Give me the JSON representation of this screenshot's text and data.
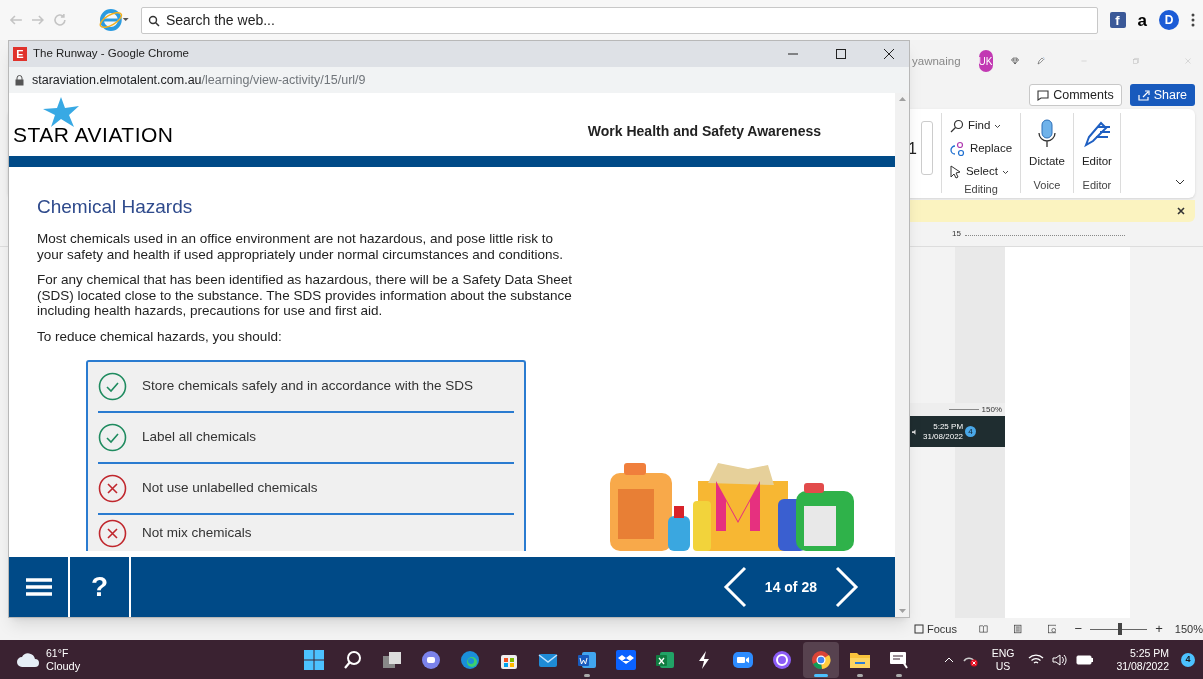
{
  "browser": {
    "search": {
      "placeholder": "Search the web..."
    },
    "extensions": [
      {
        "kind": "facebook",
        "glyph": "f"
      },
      {
        "kind": "amazon",
        "glyph": "a"
      },
      {
        "kind": "dashlane",
        "glyph": "D"
      }
    ]
  },
  "word": {
    "user": "yawnaing",
    "avatar": "UK",
    "buttons": [
      {
        "kind": "comments",
        "label": "Comments"
      },
      {
        "kind": "share",
        "label": "Share"
      }
    ],
    "font_size": "1",
    "ribbon_groups": [
      {
        "kind": "editing",
        "label": "Editing",
        "items": [
          {
            "kind": "find",
            "label": "Find"
          },
          {
            "kind": "replace",
            "label": "Replace"
          },
          {
            "kind": "select",
            "label": "Select"
          }
        ]
      },
      {
        "kind": "voice",
        "label": "Voice",
        "items": [
          {
            "kind": "dictate",
            "label": "Dictate"
          }
        ]
      },
      {
        "kind": "editor",
        "label": "Editor",
        "items": [
          {
            "kind": "editor",
            "label": "Editor"
          }
        ]
      }
    ],
    "ruler_label": "15",
    "pasted_screenshot": {
      "zoom": "150%",
      "time": "5:25 PM",
      "date": "31/08/2022",
      "badge": "4"
    },
    "status_bar": {
      "focus": "Focus",
      "zoom_out": "−",
      "zoom_slider": {
        "level": 0.55
      },
      "zoom_in": "+",
      "zoom": "150%"
    }
  },
  "popup": {
    "app_icon": "E",
    "title": "The Runway - Google Chrome",
    "url_domain": "staraviation.elmotalent.com.au",
    "url_path": "/learning/view-activity/15/url/9",
    "course": {
      "logo": "STAR AVIATION",
      "course_title": "Work Health and Safety Awareness",
      "heading": "Chemical Hazards",
      "paragraphs": [
        "Most chemicals used in an office environment are not hazardous, and pose little risk to your safety and health if used appropriately under normal circumstances and conditions.",
        "For any chemical that has been identified as hazardous, there will be a Safety Data Sheet (SDS) located close to the substance. The SDS provides information about the substance including health hazards, precautions for use and first aid.",
        "To reduce chemical hazards, you should:"
      ],
      "checklist": [
        {
          "kind": "check",
          "text": "Store chemicals safely and in accordance with the SDS"
        },
        {
          "kind": "check",
          "text": "Label all chemicals"
        },
        {
          "kind": "cross",
          "text": "Not use unlabelled chemicals"
        },
        {
          "kind": "cross",
          "text": "Not mix chemicals"
        }
      ],
      "nav": {
        "help": "?",
        "page": "14 of 28"
      }
    }
  },
  "taskbar": {
    "weather": {
      "temperature": "61°F",
      "condition": "Cloudy"
    },
    "apps": [
      {
        "kind": "start",
        "running": false,
        "selected": false
      },
      {
        "kind": "search",
        "running": false,
        "selected": false
      },
      {
        "kind": "taskview",
        "running": false,
        "selected": false
      },
      {
        "kind": "chat",
        "running": false,
        "selected": false
      },
      {
        "kind": "edge",
        "running": false,
        "selected": false
      },
      {
        "kind": "store",
        "running": false,
        "selected": false
      },
      {
        "kind": "mail",
        "running": false,
        "selected": false
      },
      {
        "kind": "word",
        "running": true,
        "selected": false
      },
      {
        "kind": "dropbox",
        "running": false,
        "selected": false
      },
      {
        "kind": "excel",
        "running": false,
        "selected": false
      },
      {
        "kind": "bolt",
        "running": false,
        "selected": false
      },
      {
        "kind": "zoom",
        "running": false,
        "selected": false
      },
      {
        "kind": "ring",
        "running": false,
        "selected": false
      },
      {
        "kind": "chrome",
        "running": true,
        "selected": true
      },
      {
        "kind": "explorer",
        "running": true,
        "selected": false
      },
      {
        "kind": "whiteboard",
        "running": true,
        "selected": false
      }
    ],
    "tray": {
      "language": "ENG",
      "region": "US",
      "time": "5:25 PM",
      "date": "31/08/2022",
      "badge": "4"
    }
  }
}
